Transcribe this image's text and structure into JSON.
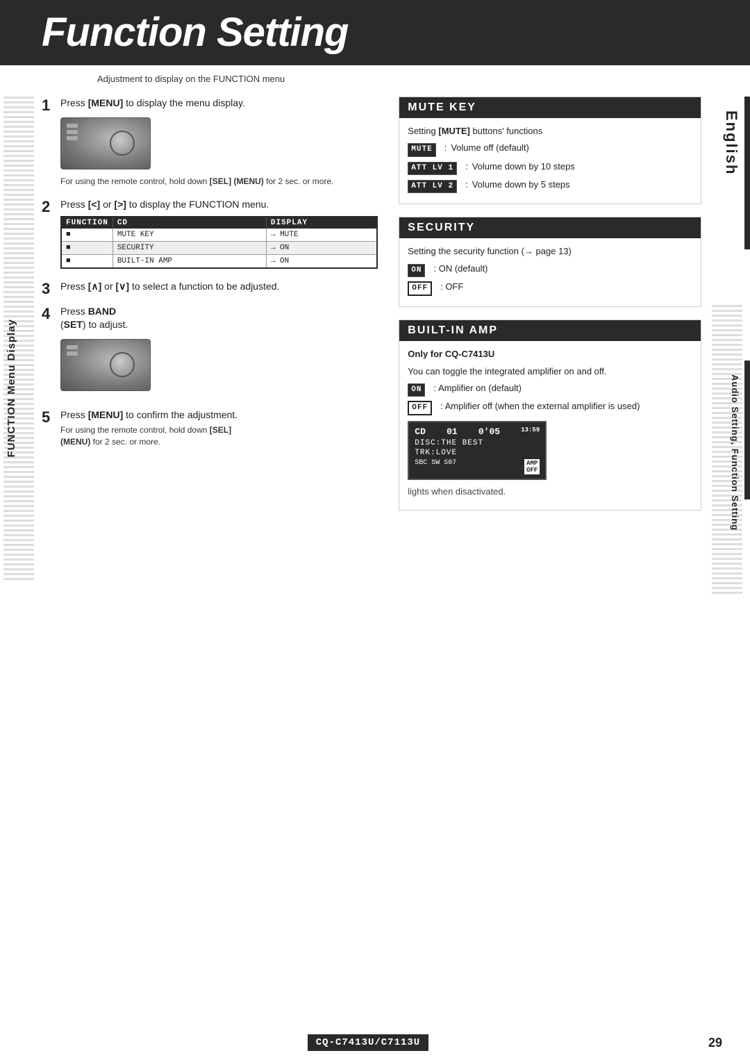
{
  "header": {
    "title": "Function Setting",
    "subtitle": "Adjustment to display on the FUNCTION menu"
  },
  "steps": [
    {
      "number": "1",
      "main": "Press [MENU] to display the menu display.",
      "note": "For using the remote control, hold down [SEL] (MENU) for 2 sec. or more."
    },
    {
      "number": "2",
      "main": "Press [<] or [>] to display the FUNCTION menu."
    },
    {
      "number": "3",
      "main": "Press [∧] or [∨] to select a function to be adjusted."
    },
    {
      "number": "4",
      "main": "Press BAND (SET) to adjust."
    },
    {
      "number": "5",
      "main": "Press [MENU] to confirm the adjustment.",
      "note": "For using the remote control, hold down [SEL] (MENU) for 2 sec. or more."
    }
  ],
  "menu_table": {
    "columns": [
      "FUNCTION",
      "CD",
      "DISPLAY"
    ],
    "rows": [
      [
        "■",
        "MUTE KEY",
        "→ MUTE"
      ],
      [
        "■",
        "SECURITY",
        "→ ON"
      ],
      [
        "■",
        "BUILT-IN AMP",
        "→ ON"
      ]
    ]
  },
  "mute_key": {
    "title": "MUTE KEY",
    "setting_label": "Setting [MUTE] buttons' functions",
    "options": [
      {
        "label": "MUTE",
        "style": "lcd",
        "colon": ":",
        "desc": "Volume off (default)"
      },
      {
        "label": "ATT LV 1",
        "style": "lcd",
        "colon": ":",
        "desc": "Volume down by 10 steps"
      },
      {
        "label": "ATT LV 2",
        "style": "lcd",
        "colon": ":",
        "desc": "Volume down by 5 steps"
      }
    ]
  },
  "security": {
    "title": "SECURITY",
    "setting_label": "Setting the security function (→ page 13)",
    "options": [
      {
        "label": "ON",
        "style": "lcd",
        "desc": ": ON (default)"
      },
      {
        "label": "OFF",
        "style": "outline",
        "desc": ": OFF"
      }
    ]
  },
  "built_in_amp": {
    "title": "BUILT-IN AMP",
    "subtitle": "Only for CQ-C7413U",
    "intro": "You can toggle the integrated amplifier on and off.",
    "options": [
      {
        "label": "ON",
        "style": "lcd",
        "desc": ": Amplifier on (default)"
      },
      {
        "label": "OFF",
        "style": "outline",
        "desc": ": Amplifier off (when the external amplifier is used)"
      }
    ],
    "screen": {
      "top_left": "CD",
      "top_mid": "01",
      "top_right": "0'05",
      "time": "13:59",
      "row1": "DISC:THE BEST",
      "row2": "TRK:LOVE",
      "bottom_left": "SBC SW S07",
      "bottom_right": "AMP OFF"
    },
    "lights_note": "lights when disactivated."
  },
  "sidebar_left": {
    "label": "FUNCTION Menu Display"
  },
  "sidebar_right": {
    "label": "Audio Setting, Function Setting"
  },
  "english_label": "English",
  "footer": {
    "model": "CQ-C7413U/C7113U",
    "page": "29"
  }
}
